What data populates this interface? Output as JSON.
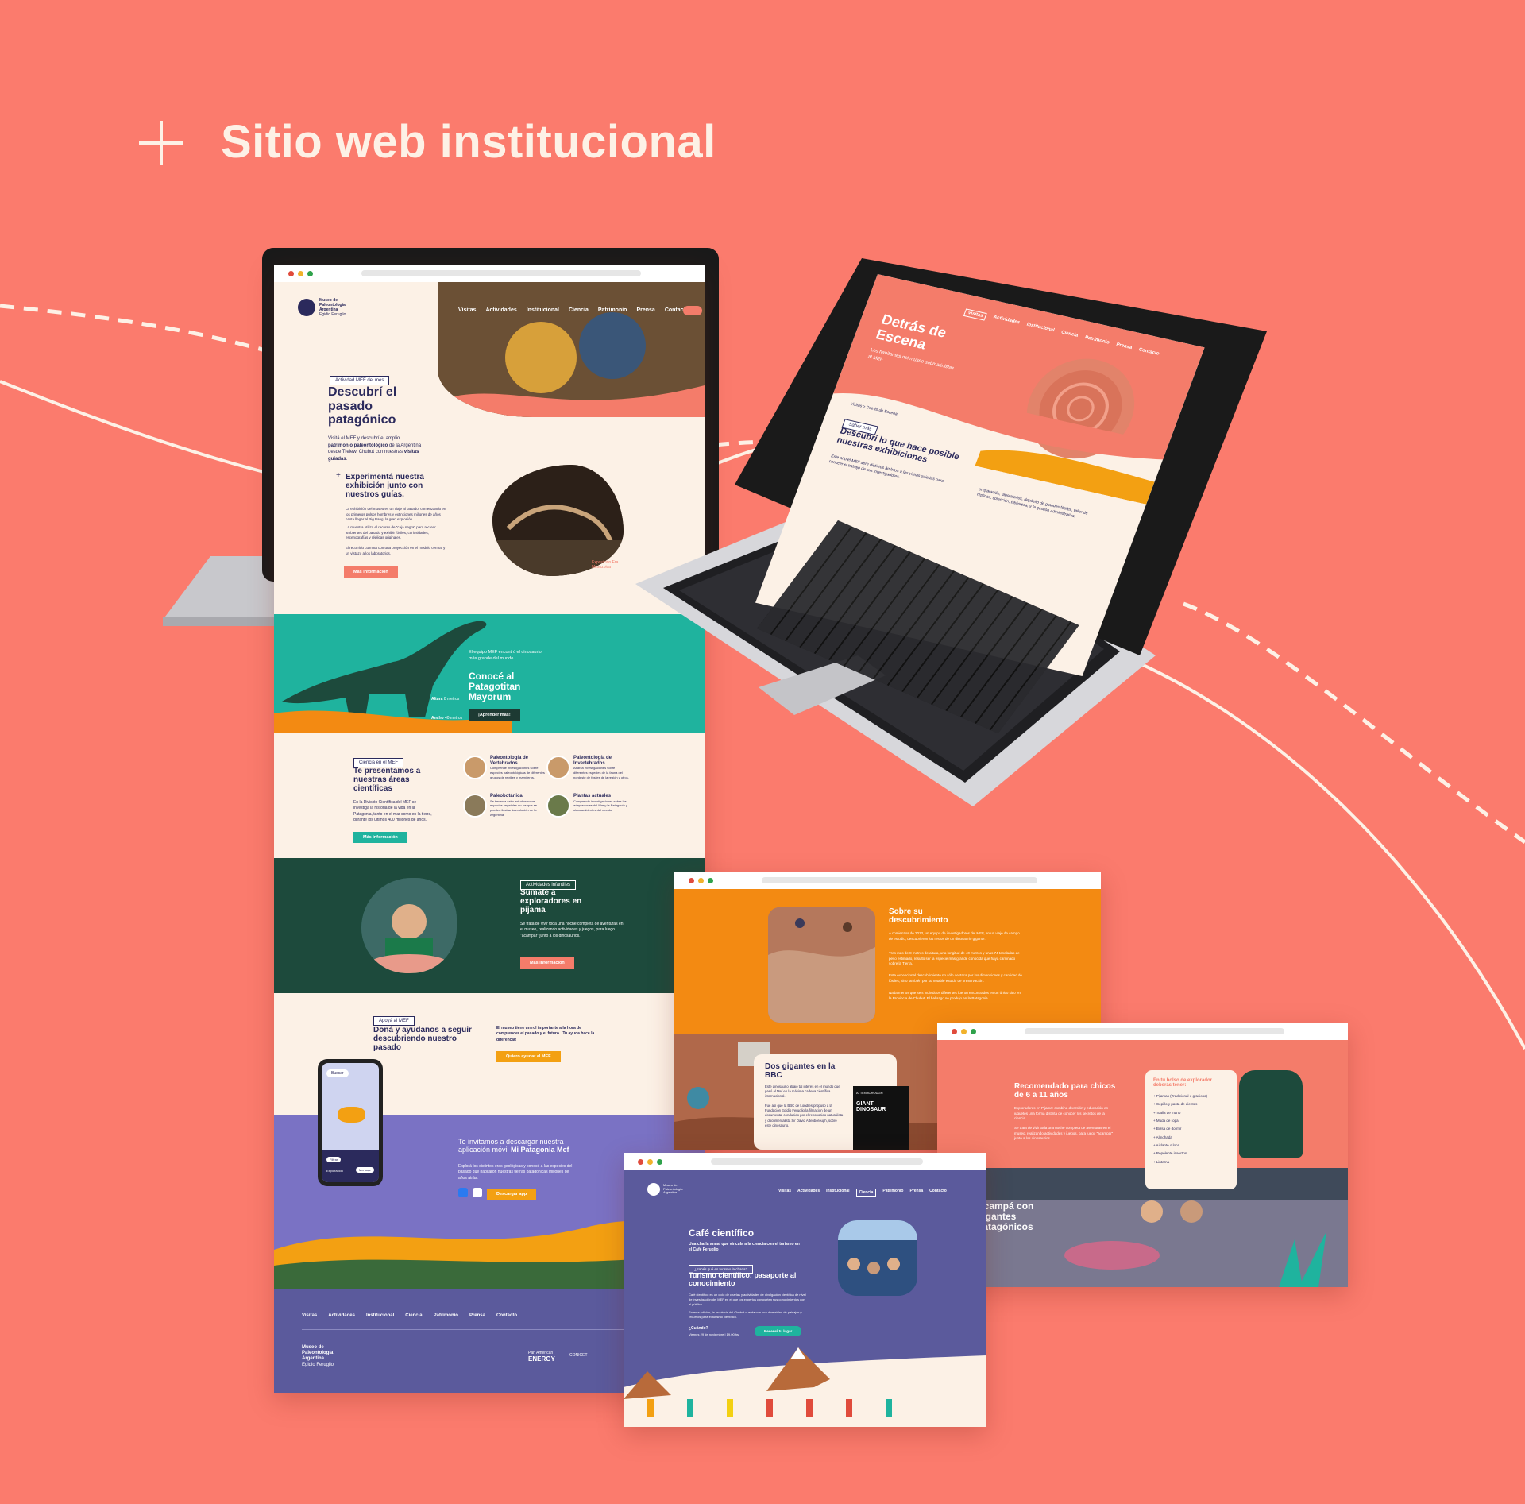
{
  "heading": {
    "title": "Sitio web institucional"
  },
  "colors": {
    "background": "#fb7b6d",
    "coral": "#f47c6a",
    "teal": "#1fb39e",
    "dark_green": "#1d4a3c",
    "purple": "#7a72c4",
    "orange": "#f38a12",
    "navy": "#2b2a5c",
    "cream": "#fcf1e6"
  },
  "main_site": {
    "logo": {
      "line1": "Museo de",
      "line2": "Paleontología",
      "line3": "Argentina",
      "line4": "Egidio Feruglio"
    },
    "nav": [
      "Visitas",
      "Actividades",
      "Institucional",
      "Ciencia",
      "Patrimonio",
      "Prensa",
      "Contacto"
    ],
    "hero": {
      "tag": "Actividad MEF del mes",
      "title": "Descubrí el pasado patagónico",
      "text_pre": "Visitá el MEF y descubrí el amplio ",
      "text_bold": "patrimonio paleontológico",
      "text_post": " de la Argentina desde Trelew, Chubut con nuestras ",
      "text_bold2": "visitas guiadas",
      "text_end": "."
    },
    "exhibit": {
      "title": "Experimentá nuestra exhibición junto con nuestros guías.",
      "p1": "La exhibición del museo es un viaje al pasado, comenzando en los primeros pulsos hombres y extinciones millones de años hasta llegar al Big Bang, la gran explosión.",
      "p2": "La muestra utiliza el recurso de \"caja negra\" para recrear ambientes del pasado y exhibir fósiles, curiosidades, escenografías y réplicas originales.",
      "p3": "El recorrido culmina con una proyección en el módulo central y un vistazo a los laboratorios.",
      "button": "Más información",
      "caption": "Exposición Era Mesozoica"
    },
    "dino": {
      "intro": "El equipo MEF encontró el dinosaurio más grande del mundo",
      "title": "Conocé al Patagotitan Mayorum",
      "button": "¡Aprender más!",
      "height_label": "Altura",
      "height_value": "8 metros",
      "length_label": "Ancho",
      "length_value": "40 metros"
    },
    "science": {
      "tag": "Ciencia en el MEF",
      "title": "Te presentamos a nuestras áreas científicas",
      "text": "En la División Científica del MEF se investiga la historia de la vida en la Patagonia, tanto en el mar como en la tierra, durante los últimos 400 millones de años.",
      "button": "Más información",
      "areas": [
        {
          "name": "Paleontología de Vertebrados",
          "desc": "Comprende investigaciones sobre especies paleontológicas de diferentes grupos de reptiles y mamíferos."
        },
        {
          "name": "Paleontología de Invertebrados",
          "desc": "Abarca investigaciones sobre diferentes especies de la fauna del nordeste de fósiles de la región y otros."
        },
        {
          "name": "Paleobotánica",
          "desc": "Se tienen a cabo estudios sobre especies vegetales en los que se pueden ilustrar la evolución de la Argentina."
        },
        {
          "name": "Plantas actuales",
          "desc": "Comprende investigaciones sobre las adaptaciones del Mar y la Patagonia y otros ambientes del mundo."
        }
      ]
    },
    "kids": {
      "tag": "Actividades infantiles",
      "title": "Sumate a exploradores en pijama",
      "text": "Se trata de vivir toda una noche completa de aventuras en el museo, realizando actividades y juegos, para luego \"acampar\" junto a los dinosaurios.",
      "button": "Más información"
    },
    "support": {
      "tag": "Apoyá al MEF",
      "title": "Doná y ayudanos a seguir descubriendo nuestro pasado",
      "text": "El museo tiene un rol importante a la hora de comprender el pasado y el futuro. ¡Tu ayuda hace la diferencia!",
      "button": "Quiero ayudar al MEF"
    },
    "app": {
      "title_pre": "Te invitamos a descargar nuestra aplicación móvil ",
      "title_bold": "Mi Patagonia Mef",
      "text": "Explorá los distintos eras geológicas y conocé a las especies del pasado que habitaron nuestras tierras patagónicas millones de años atrás.",
      "button": "Descargar app",
      "phone_search": "Buscar",
      "phone_btn1": "Filtrar",
      "phone_btn2": "Exploración",
      "phone_btn3": "Mensaje"
    },
    "footer": {
      "nav": [
        "Visitas",
        "Actividades",
        "Institucional",
        "Ciencia",
        "Patrimonio",
        "Prensa",
        "Contacto"
      ],
      "logo_line1": "Museo de",
      "logo_line2": "Paleontología",
      "logo_line3": "Argentina",
      "logo_line4": "Egidio Feruglio",
      "sponsor1_a": "Pan American",
      "sponsor1_b": "ENERGY",
      "sponsor2": "CONICET"
    }
  },
  "laptop": {
    "nav": [
      "Visitas",
      "Actividades",
      "Institucional",
      "Ciencia",
      "Patrimonio",
      "Prensa",
      "Contacto"
    ],
    "title": "Detrás de Escena",
    "subtitle": "Los habitantes del museo submarinistas al MEF",
    "breadcrumb": "Visitas > Detrás de Escena",
    "tag": "Saber más",
    "heading": "Descubrí lo que hace posible nuestras exhibiciones",
    "p1": "Este año el MEF abre distintos ámbitos a las visitas guiadas para conocer el trabajo de sus investigadores.",
    "p2": "preparación, laboratorios, depósito de grandes fósiles, taller de réplicas, colección, biblioteca, y la gestión administrativa."
  },
  "win_orange": {
    "title": "Sobre su descubrimiento",
    "p1": "A comienzos de 2013, un equipo de investigadores del MEF, en un viaje de campo de estudio, descubrieron los restos de un dinosaurio gigante.",
    "p2": "Tres más de 8 metros de altura, una longitud de 40 metros y unas 74 toneladas de peso estimado, resultó ser la especie mas grande conocida que haya caminado sobre la Tierra.",
    "p3": "Esta excepcional descubrimiento no sólo destaca por los dimensiones y cantidad de fósiles, sino también por su notable estado de preservación.",
    "p4": "Nada menos que seis individuos diferentes fueron encontrados en un único sitio en la Provincia de Chubut. El hallazgo se produjo en la Patagonia.",
    "card_title": "Dos gigantes en la BBC",
    "card_p1": "Este dinosaurio atrajo tal interés en el mundo que pasó al Mef en la máxima cadena científica internacional.",
    "card_p2": "Fue así que la BBC de Londres propuso a la Fundación Egidio Feruglio la filmación de un documental conducido por el reconocido naturalista y documentalista Sir David Attenborough, sobre este dinosaurio.",
    "book_line1": "ATTENBOROUGH",
    "book_line2": "GIANT",
    "book_line3": "DINOSAUR"
  },
  "win_coral": {
    "title": "Recomendado para chicos de 6 a 11 años",
    "text": "Exploradores en Pijama: combina diversión y educación en juguetes una forma distinta de conocer los secretos de la ciencia.",
    "text2": "Se trata de vivir toda una noche completa de aventuras en el museo, realizando actividades y juegos, para luego \"acampar\" junto a los dinosaurios.",
    "list_title": "En tu bolso de explorador deberás tener:",
    "list": [
      "Pijamas (Tradicional o gracioso)",
      "Cepillo y pasta de dientes",
      "Toalla de mano",
      "Muda de ropa",
      "Bolsa de dormir",
      "Almohada",
      "Aislante o lona",
      "Repelente insectos",
      "Linterna"
    ],
    "bottom_title": "Acampá con gigantes patagónicos"
  },
  "win_purple": {
    "nav": [
      "Visitas",
      "Actividades",
      "Institucional",
      "Ciencia",
      "Patrimonio",
      "Prensa",
      "Contacto"
    ],
    "title": "Café científico",
    "subtitle": "Una charla anual que vincula a la ciencia con el turismo en el Café Feruglio",
    "tag": "¿Sabés qué es turismo la charla?",
    "heading": "Turismo científico: pasaporte al conocimiento",
    "text": "Café científico es un ciclo de charlas y actividades de divulgación científica de nivel de investigación del MEF en el que los expertos comparten sus conocimientos con el público.",
    "text2": "En esta edición, la provincia del Chubut cuenta con una diversidad de paisajes y recursos para el turismo científico.",
    "when_label": "¿Cuándo?",
    "when_value": "Viernes 29 de noviembre | 19.00 hs",
    "button": "Reservá tu lugar"
  }
}
